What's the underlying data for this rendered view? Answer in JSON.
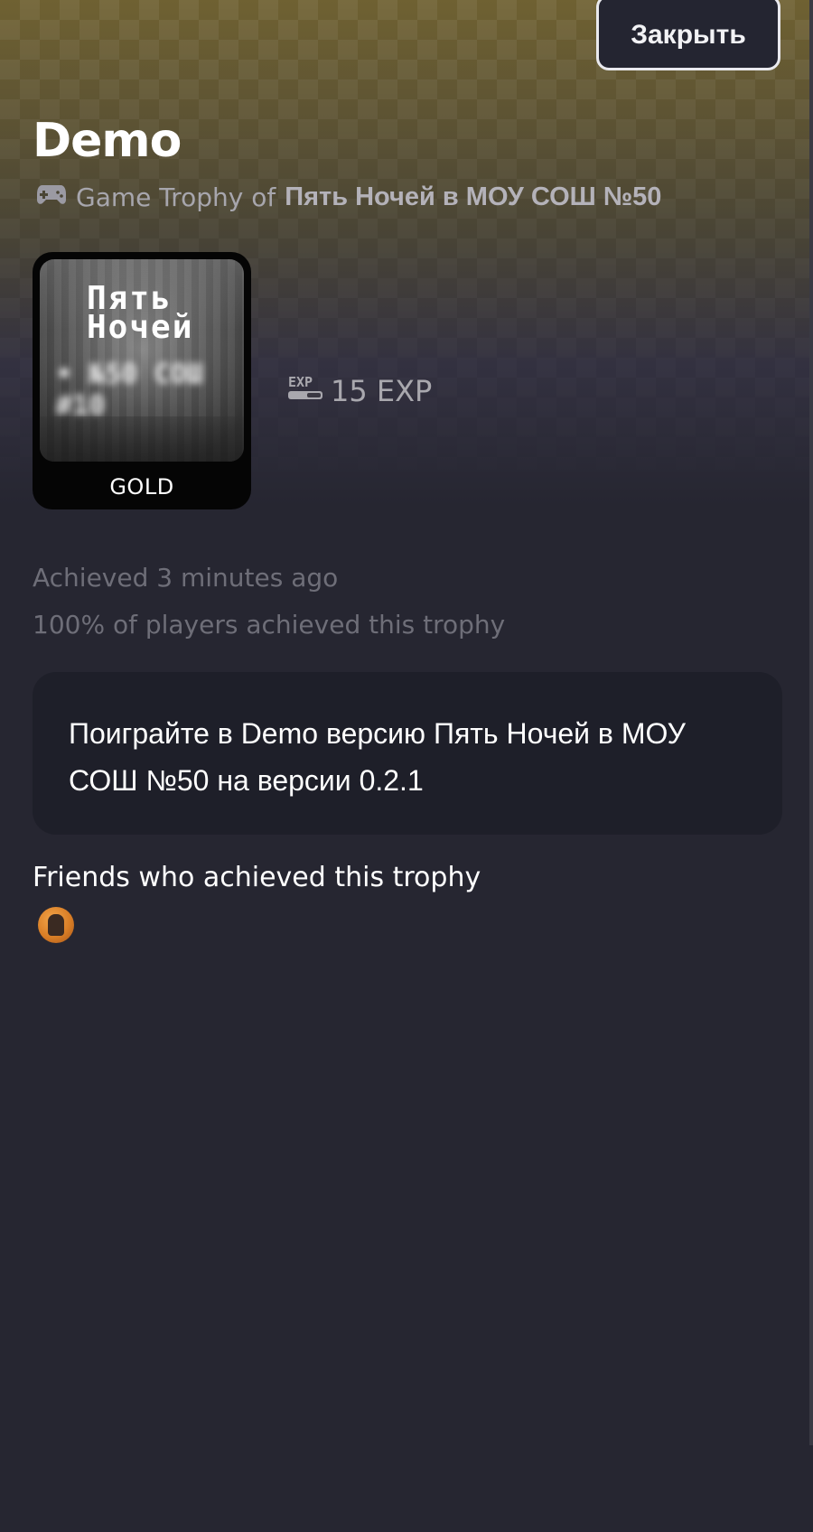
{
  "header": {
    "close_label": "Закрыть"
  },
  "trophy": {
    "title": "Demo",
    "subtitle_prefix": "Game Trophy of",
    "game_name": "Пять Ночей в МОУ СОШ №50",
    "tier": "GOLD",
    "image_text_line1": "Пять",
    "image_text_line2": "Ночей",
    "exp_label": "15 EXP",
    "achieved_text": "Achieved 3 minutes ago",
    "percent_text": "100% of players achieved this trophy",
    "description": "Поиграйте в Demo версию Пять Ночей в МОУ СОШ №50 на версии 0.2.1"
  },
  "friends": {
    "heading": "Friends who achieved this trophy",
    "avatars": [
      "friend-avatar"
    ]
  },
  "colors": {
    "background": "#262631",
    "card_bg": "#1e1f29",
    "header_gold": "#6f6132",
    "muted_text": "#6e6e78",
    "close_button_bg": "#242531",
    "friend_avatar": "#d97e26"
  },
  "icons": {
    "gamepad": "gamepad-icon",
    "exp": "exp-icon"
  }
}
